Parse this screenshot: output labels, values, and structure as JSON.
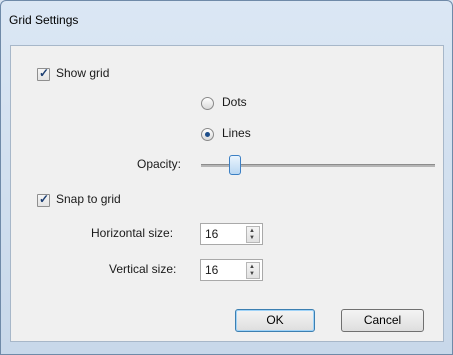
{
  "window": {
    "title": "Grid Settings"
  },
  "show_grid": {
    "label": "Show grid",
    "checked": true
  },
  "grid_style": {
    "options": [
      {
        "label": "Dots",
        "selected": false
      },
      {
        "label": "Lines",
        "selected": true
      }
    ]
  },
  "opacity": {
    "label": "Opacity:"
  },
  "snap": {
    "label": "Snap to grid",
    "checked": true
  },
  "horizontal": {
    "label": "Horizontal size:",
    "value": "16"
  },
  "vertical": {
    "label": "Vertical size:",
    "value": "16"
  },
  "buttons": {
    "ok": "OK",
    "cancel": "Cancel"
  }
}
